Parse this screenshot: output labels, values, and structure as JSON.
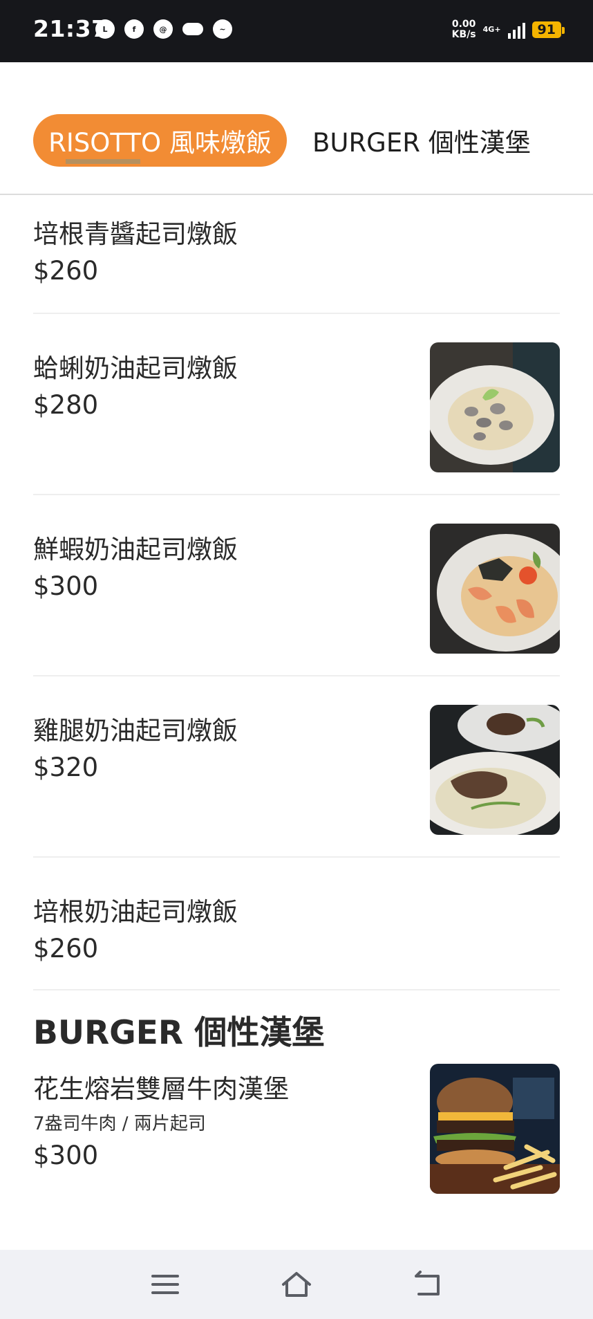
{
  "status_bar": {
    "time": "21:37",
    "notification_icons": [
      "line-icon",
      "facebook-icon",
      "threads-icon",
      "cloud-icon",
      "messenger-icon"
    ],
    "speed_value": "0.00",
    "speed_unit": "KB/s",
    "network": "4G+",
    "battery": "91"
  },
  "tabs": [
    {
      "label": "RISOTTO 風味燉飯",
      "active": true
    },
    {
      "label": "BURGER 個性漢堡",
      "active": false
    }
  ],
  "risotto_items": [
    {
      "name": "培根青醬起司燉飯",
      "price": "$260",
      "has_photo": false
    },
    {
      "name": "蛤蜊奶油起司燉飯",
      "price": "$280",
      "has_photo": true
    },
    {
      "name": "鮮蝦奶油起司燉飯",
      "price": "$300",
      "has_photo": true
    },
    {
      "name": "雞腿奶油起司燉飯",
      "price": "$320",
      "has_photo": true
    },
    {
      "name": "培根奶油起司燉飯",
      "price": "$260",
      "has_photo": false
    }
  ],
  "burger_section": {
    "title": "BURGER 個性漢堡",
    "items": [
      {
        "name": "花生熔岩雙層牛肉漢堡",
        "description": "7盎司牛肉 / 兩片起司",
        "price": "$300",
        "has_photo": true
      }
    ]
  },
  "colors": {
    "accent": "#f28c34",
    "status_bar": "#16171b",
    "battery": "#f4b400",
    "nav_bar": "#f0f1f5"
  },
  "nav_bar": {
    "icons": [
      "menu-icon",
      "home-icon",
      "back-icon"
    ]
  }
}
